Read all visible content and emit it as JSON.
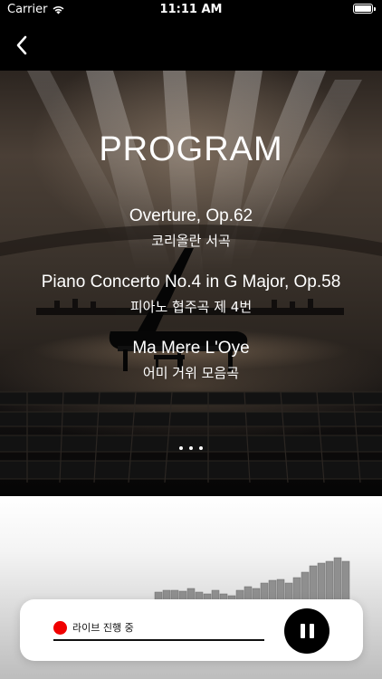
{
  "status_bar": {
    "carrier": "Carrier",
    "time": "11:11 AM"
  },
  "nav": {
    "back_icon": "chevron-left-icon"
  },
  "program": {
    "title": "PROGRAM",
    "pieces": [
      {
        "title_en": "Overture, Op.62",
        "title_ko": "코리올란 서곡"
      },
      {
        "title_en": "Piano Concerto No.4 in G Major, Op.58",
        "title_ko": "피아노 협주곡 제 4번"
      },
      {
        "title_en": "Ma Mere L'Oye",
        "title_ko": "어미 거위 모음곡"
      }
    ],
    "more_icon": "more-horizontal-icon"
  },
  "player": {
    "live_label": "라이브 진행 중",
    "live_color": "#f00000",
    "pause_icon": "pause-icon"
  }
}
